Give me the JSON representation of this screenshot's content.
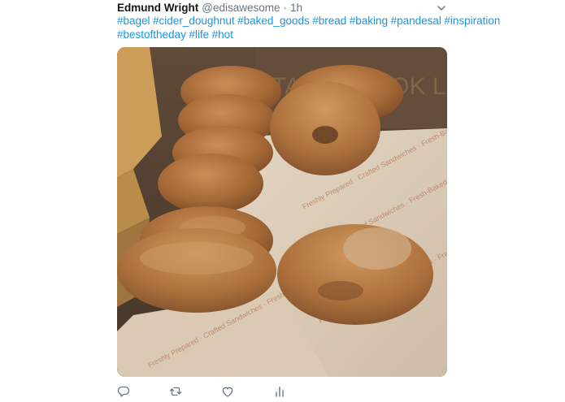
{
  "tweet": {
    "author": {
      "display_name": "Edmund Wright",
      "handle": "@edisawesome",
      "separator": "·",
      "time": "1h"
    },
    "hashtags": [
      "#bagel",
      "#cider_doughnut",
      "#baked_goods",
      "#bread",
      "#baking",
      "#pandesal",
      "#inspiration",
      "#bestoftheday",
      "#life",
      "#hot"
    ],
    "media": {
      "box_print_text": "TASTE BOOK LIKE",
      "wrapper_print_text": "Freshly Prepared · Crafted Sandwiches · Fresh-Baked Bagels"
    },
    "actions": {
      "reply_icon": "reply-icon",
      "retweet_icon": "retweet-icon",
      "like_icon": "heart-icon",
      "analytics_icon": "analytics-icon",
      "more_icon": "chevron-down-icon"
    },
    "colors": {
      "link": "#1b95e0",
      "secondary_text": "#657786",
      "icon": "#657786"
    }
  }
}
